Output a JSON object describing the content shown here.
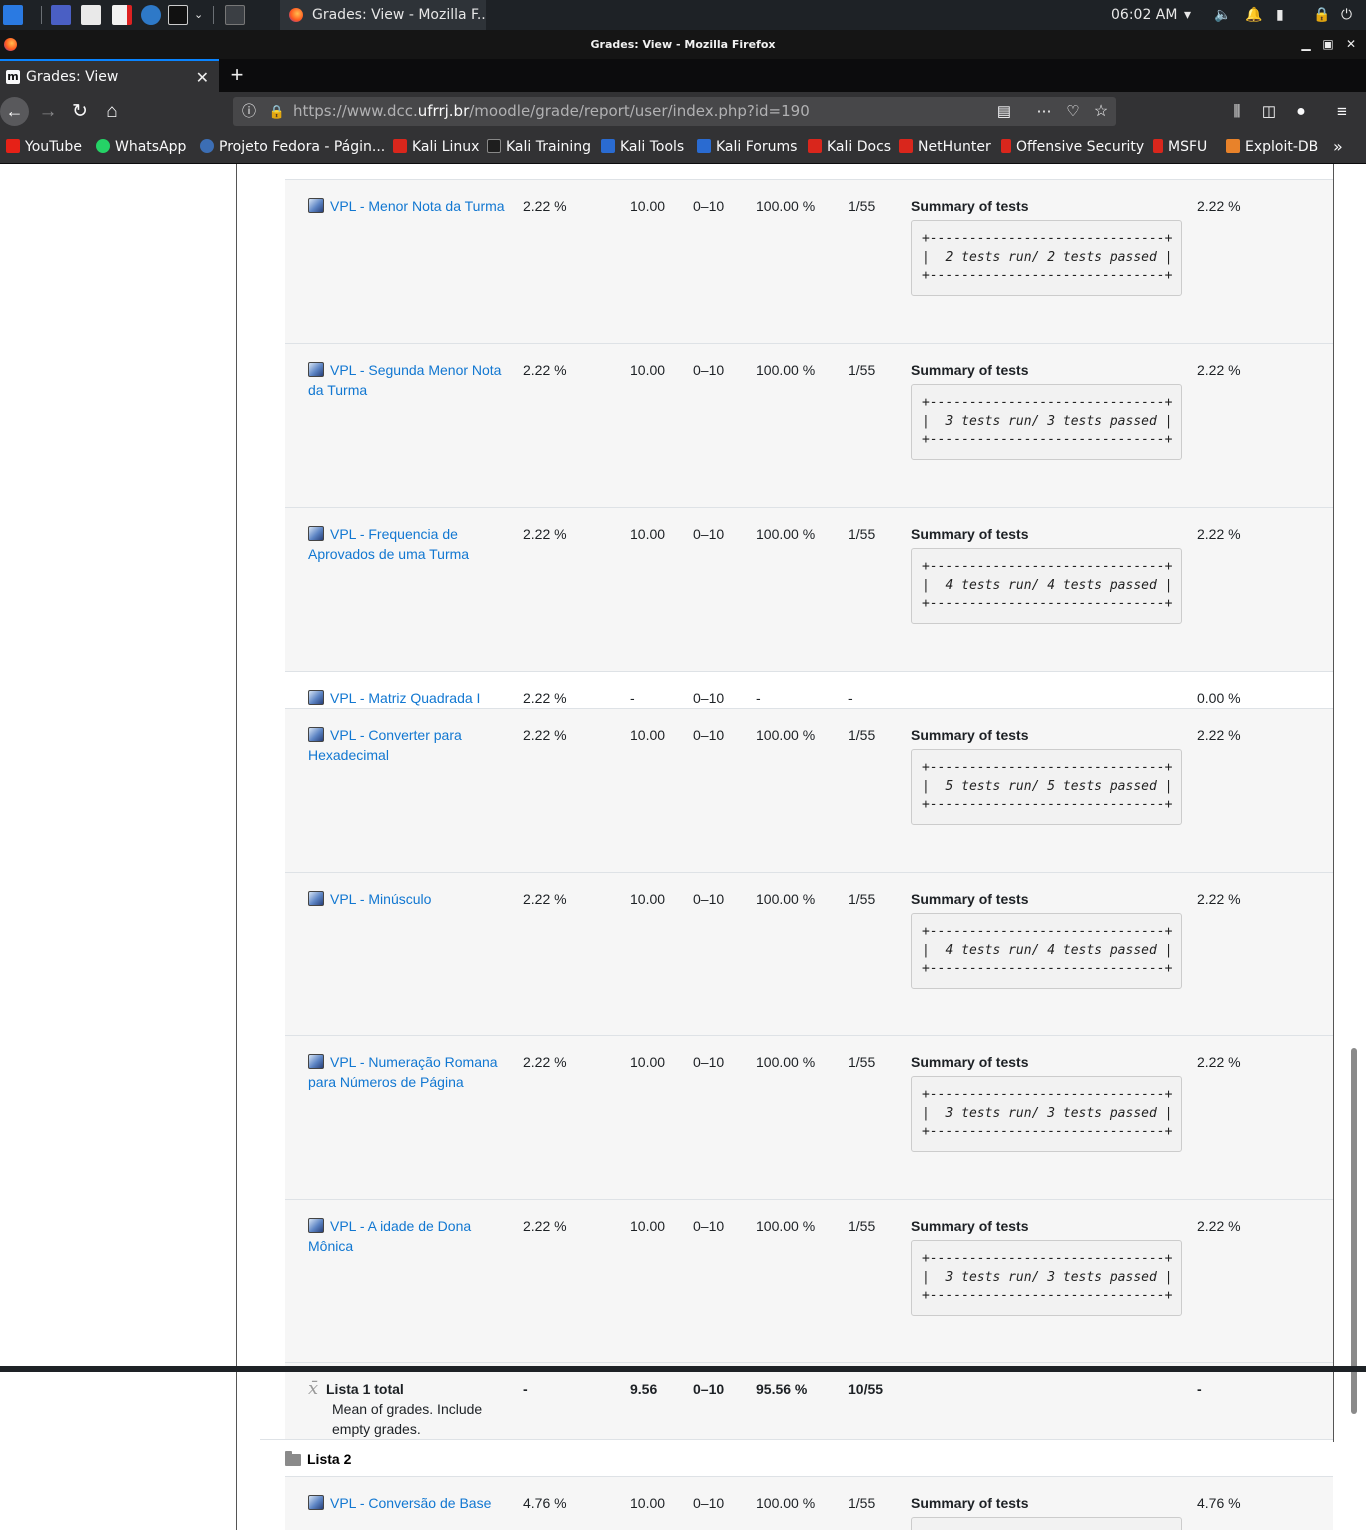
{
  "os": {
    "clock": "06:02 AM",
    "task_title": "Grades: View - Mozilla F..."
  },
  "window": {
    "title": "Grades: View - Mozilla Firefox"
  },
  "tab": {
    "title": "Grades: View",
    "favicon": "m"
  },
  "url": {
    "prefix": "https://www.dcc.",
    "domain": "ufrrj.br",
    "path": "/moodle/grade/report/user/index.php?id=190"
  },
  "bookmarks": [
    {
      "label": "YouTube",
      "color": "#e62117"
    },
    {
      "label": "WhatsApp",
      "color": "#25d366"
    },
    {
      "label": "Projeto Fedora - Págin...",
      "color": "#3c6eb4"
    },
    {
      "label": "Kali Linux",
      "color": "#d9261c"
    },
    {
      "label": "Kali Training",
      "color": "#1e1e1e"
    },
    {
      "label": "Kali Tools",
      "color": "#2a6bd1"
    },
    {
      "label": "Kali Forums",
      "color": "#2a6bd1"
    },
    {
      "label": "Kali Docs",
      "color": "#d9261c"
    },
    {
      "label": "NetHunter",
      "color": "#d9261c"
    },
    {
      "label": "Offensive Security",
      "color": "#d9261c"
    },
    {
      "label": "MSFU",
      "color": "#d9261c"
    },
    {
      "label": "Exploit-DB",
      "color": "#e8822a"
    }
  ],
  "grades": {
    "summary_title": "Summary of tests",
    "rows": [
      {
        "item": "VPL - Menor Nota da Turma",
        "weight": "2.22 %",
        "grade": "10.00",
        "range": "0–10",
        "percentage": "100.00 %",
        "rank": "1/55",
        "tests": "+------------------------------+\n|  2 tests run/ 2 tests passed |\n+------------------------------+",
        "contribution": "2.22 %"
      },
      {
        "item": "VPL - Segunda Menor Nota da Turma",
        "weight": "2.22 %",
        "grade": "10.00",
        "range": "0–10",
        "percentage": "100.00 %",
        "rank": "1/55",
        "tests": "+------------------------------+\n|  3 tests run/ 3 tests passed |\n+------------------------------+",
        "contribution": "2.22 %"
      },
      {
        "item": "VPL - Frequencia de Aprovados de uma Turma",
        "weight": "2.22 %",
        "grade": "10.00",
        "range": "0–10",
        "percentage": "100.00 %",
        "rank": "1/55",
        "tests": "+------------------------------+\n|  4 tests run/ 4 tests passed |\n+------------------------------+",
        "contribution": "2.22 %"
      },
      {
        "item": "VPL - Matriz Quadrada I",
        "weight": "2.22 %",
        "grade": "-",
        "range": "0–10",
        "percentage": "-",
        "rank": "-",
        "contribution": "0.00 %"
      },
      {
        "item": "VPL - Converter para Hexadecimal",
        "weight": "2.22 %",
        "grade": "10.00",
        "range": "0–10",
        "percentage": "100.00 %",
        "rank": "1/55",
        "tests": "+------------------------------+\n|  5 tests run/ 5 tests passed |\n+------------------------------+",
        "contribution": "2.22 %"
      },
      {
        "item": "VPL - Minúsculo",
        "weight": "2.22 %",
        "grade": "10.00",
        "range": "0–10",
        "percentage": "100.00 %",
        "rank": "1/55",
        "tests": "+------------------------------+\n|  4 tests run/ 4 tests passed |\n+------------------------------+",
        "contribution": "2.22 %"
      },
      {
        "item": "VPL - Numeração Romana para Números de Página",
        "weight": "2.22 %",
        "grade": "10.00",
        "range": "0–10",
        "percentage": "100.00 %",
        "rank": "1/55",
        "tests": "+------------------------------+\n|  3 tests run/ 3 tests passed |\n+------------------------------+",
        "contribution": "2.22 %"
      },
      {
        "item": "VPL - A idade de Dona Mônica",
        "weight": "2.22 %",
        "grade": "10.00",
        "range": "0–10",
        "percentage": "100.00 %",
        "rank": "1/55",
        "tests": "+------------------------------+\n|  3 tests run/ 3 tests passed |\n+------------------------------+",
        "contribution": "2.22 %"
      }
    ],
    "total": {
      "label": "Lista 1 total",
      "description": "Mean of grades. Include empty grades.",
      "weight": "-",
      "grade": "9.56",
      "range": "0–10",
      "percentage": "95.56 %",
      "rank": "10/55",
      "contribution": "-"
    },
    "category": "Lista 2",
    "next_row": {
      "item": "VPL - Conversão de Base",
      "weight": "4.76 %",
      "grade": "10.00",
      "range": "0–10",
      "percentage": "100.00 %",
      "rank": "1/55",
      "tests": "+------------------------------+",
      "contribution": "4.76 %"
    }
  }
}
